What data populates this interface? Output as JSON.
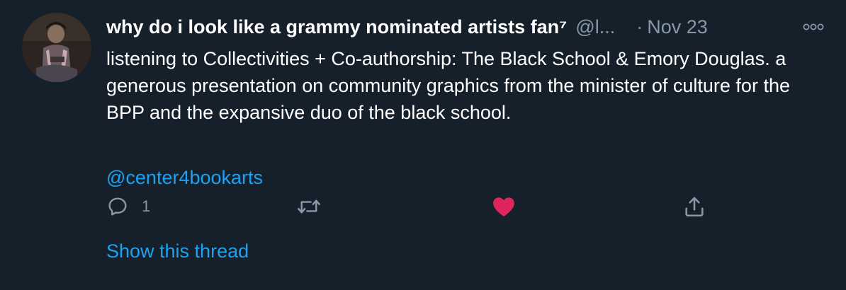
{
  "tweet": {
    "display_name": "why do i look like a grammy nominated artists fan⁷",
    "handle": "@l...",
    "separator": "·",
    "timestamp": "Nov 23",
    "text": "listening to Collectivities + Co-authorship: The Black School & Emory Douglas. a generous presentation on community graphics from the minister of culture for the BPP and the expansive duo of the black school.",
    "mention": "@center4bookarts",
    "show_thread_label": "Show this thread"
  },
  "actions": {
    "reply_count": "1",
    "retweet_count": "",
    "like_count": "",
    "liked": true
  },
  "colors": {
    "background": "#15202b",
    "secondary_text": "#8899a6",
    "link": "#1da1f2",
    "like_active": "#e0245e"
  },
  "icons": {
    "more": "more-dots-icon",
    "reply": "reply-bubble-icon",
    "retweet": "retweet-icon",
    "like": "heart-filled-icon",
    "share": "share-upload-icon"
  }
}
